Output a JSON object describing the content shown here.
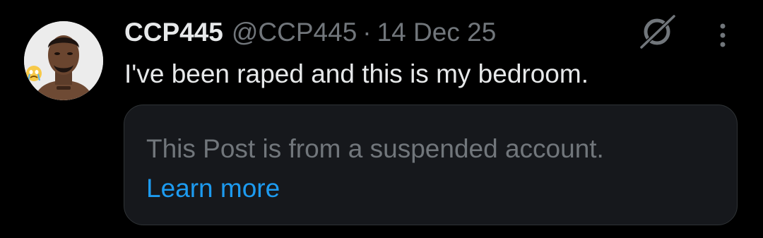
{
  "post": {
    "author": {
      "display_name": "CCP445",
      "handle": "@CCP445",
      "avatar": "profile-photo"
    },
    "separator": "·",
    "date": "14 Dec 25",
    "text": "I've been raped and this is my bedroom.",
    "icons": {
      "grok": "grok-icon",
      "more": "more-options-icon"
    },
    "quoted_notice": {
      "message": "This Post is from a suspended account.",
      "link_label": "Learn more"
    }
  },
  "colors": {
    "background": "#000000",
    "primary_text": "#e7e9ea",
    "secondary_text": "#71767b",
    "link": "#1d9bf0",
    "card_background": "#16181c",
    "card_border": "#2f3336"
  }
}
